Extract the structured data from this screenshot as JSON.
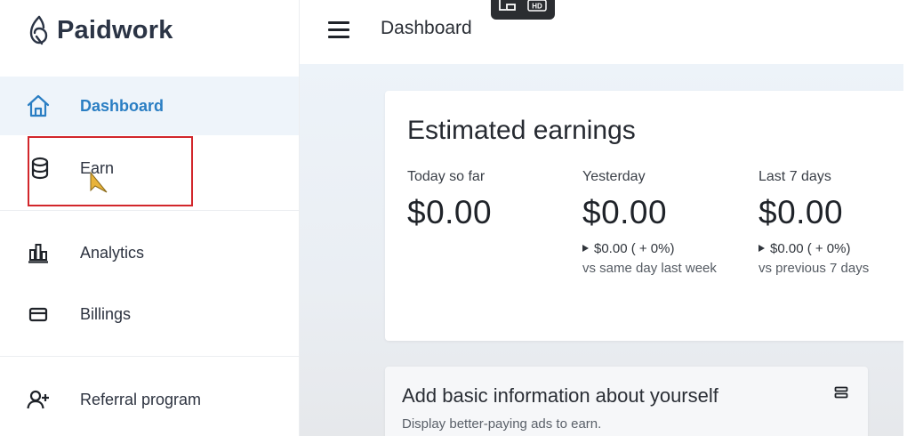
{
  "brand": {
    "name": "Paidwork"
  },
  "sidebar": {
    "items": [
      {
        "label": "Dashboard",
        "icon": "home-icon",
        "active": true
      },
      {
        "label": "Earn",
        "icon": "coins-icon",
        "active": false
      },
      {
        "label": "Analytics",
        "icon": "bar-chart-icon",
        "active": false
      },
      {
        "label": "Billings",
        "icon": "card-icon",
        "active": false
      },
      {
        "label": "Referral program",
        "icon": "add-user-icon",
        "active": false
      }
    ]
  },
  "topbar": {
    "title": "Dashboard"
  },
  "video_overlay": {
    "hd_label": "HD"
  },
  "earnings": {
    "title": "Estimated earnings",
    "stats": [
      {
        "label": "Today so far",
        "value": "$0.00",
        "change": "",
        "compare": ""
      },
      {
        "label": "Yesterday",
        "value": "$0.00",
        "change": "$0.00 ( + 0%)",
        "compare": "vs same day last week"
      },
      {
        "label": "Last 7 days",
        "value": "$0.00",
        "change": "$0.00 ( + 0%)",
        "compare": "vs previous 7 days"
      }
    ]
  },
  "info_card": {
    "title": "Add basic information about yourself",
    "subtitle": "Display better-paying ads to earn."
  },
  "colors": {
    "accent": "#2a7ec3",
    "active_bg": "#eef4fa",
    "highlight": "#d2262b",
    "cursor": "#e8b33a"
  }
}
